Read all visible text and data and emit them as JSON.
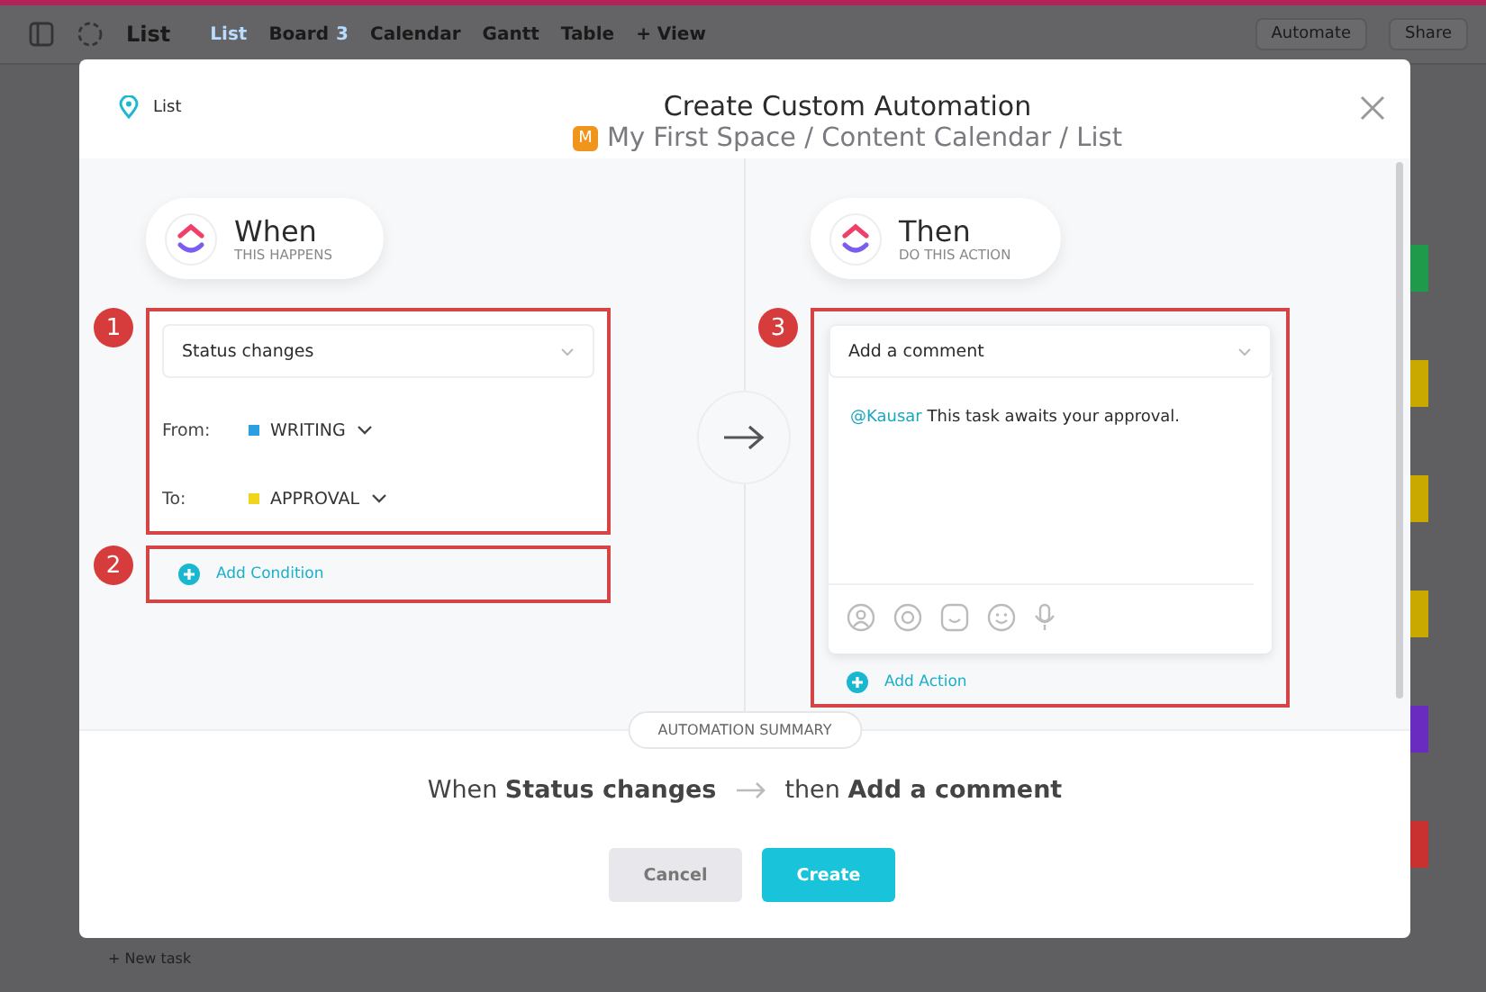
{
  "app_toolbar": {
    "title": "List",
    "views": [
      {
        "label": "List",
        "selected": true
      },
      {
        "label": "Board",
        "selected": false,
        "count": "3"
      },
      {
        "label": "Calendar",
        "selected": false
      },
      {
        "label": "Gantt",
        "selected": false
      },
      {
        "label": "Table",
        "selected": false
      }
    ],
    "add_view": "+ View",
    "automate": "Automate",
    "share": "Share"
  },
  "background": {
    "new_task": "+ New task",
    "strips": [
      {
        "color": "#1f9a4a"
      },
      {
        "color": "#c9a800"
      },
      {
        "color": "#c9a800"
      },
      {
        "color": "#c9a800"
      },
      {
        "color": "#6a2cc0"
      },
      {
        "color": "#c93030"
      }
    ]
  },
  "modal": {
    "location": "List",
    "title": "Create Custom Automation",
    "space_badge": "M",
    "breadcrumb": "My First Space / Content Calendar / List",
    "trigger": {
      "heading": "When",
      "subheading": "THIS HAPPENS",
      "select": "Status changes",
      "fields": [
        {
          "label": "From:",
          "value": "WRITING",
          "color": "#2aa0e0"
        },
        {
          "label": "To:",
          "value": "APPROVAL",
          "color": "#f0d51e"
        }
      ],
      "add_label": "Add Condition"
    },
    "action": {
      "heading": "Then",
      "subheading": "DO THIS ACTION",
      "select": "Add a comment",
      "mention": "@Kausar",
      "comment": "This task awaits your approval.",
      "add_label": "Add Action"
    },
    "summary": {
      "label": "AUTOMATION SUMMARY",
      "when": "When **Status changes**",
      "then": "then **Add a comment**"
    },
    "buttons": [
      {
        "label": "Cancel",
        "kind": "secondary"
      },
      {
        "label": "Create",
        "kind": "primary"
      }
    ]
  },
  "annotations": [
    {
      "number": "1"
    },
    {
      "number": "2"
    },
    {
      "number": "3"
    }
  ]
}
